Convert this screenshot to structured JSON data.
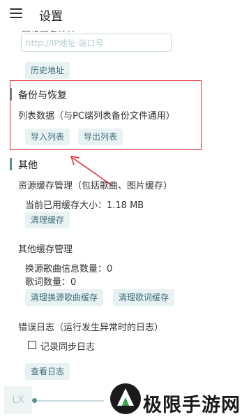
{
  "header": {
    "title": "设置"
  },
  "sync": {
    "partial_heading": "同步服务地址",
    "address_placeholder": "http://IP地址:端口号",
    "history_button": "历史地址"
  },
  "backup": {
    "heading": "备份与恢复",
    "list_data_label": "列表数据（与PC端列表备份文件通用）",
    "import_button": "导入列表",
    "export_button": "导出列表"
  },
  "other": {
    "heading": "其他",
    "resource_cache_label": "资源缓存管理（包括歌曲、图片缓存）",
    "cache_size_text": "当前已用缓存大小：1.18 MB",
    "clear_cache_button": "清理缓存",
    "other_cache_label": "其他缓存管理",
    "song_info_count_text": "换源歌曲信息数量：0",
    "lyric_count_text": "歌词数量：0",
    "clear_song_cache_button": "清理换源歌曲缓存",
    "clear_lyric_cache_button": "清理歌词缓存",
    "error_log_label": "错误日志（运行发生异常时的日志）",
    "record_sync_log_label": "记录同步日志",
    "view_log_button": "查看日志"
  },
  "player": {
    "cover_text": "LX",
    "progress": 0.0
  },
  "watermark": {
    "text": "极限手游网"
  },
  "colors": {
    "accent": "#5b8f97",
    "button_bg": "#e8f2f3",
    "button_text": "#3f6f77",
    "annotation_red": "#e0282e"
  }
}
